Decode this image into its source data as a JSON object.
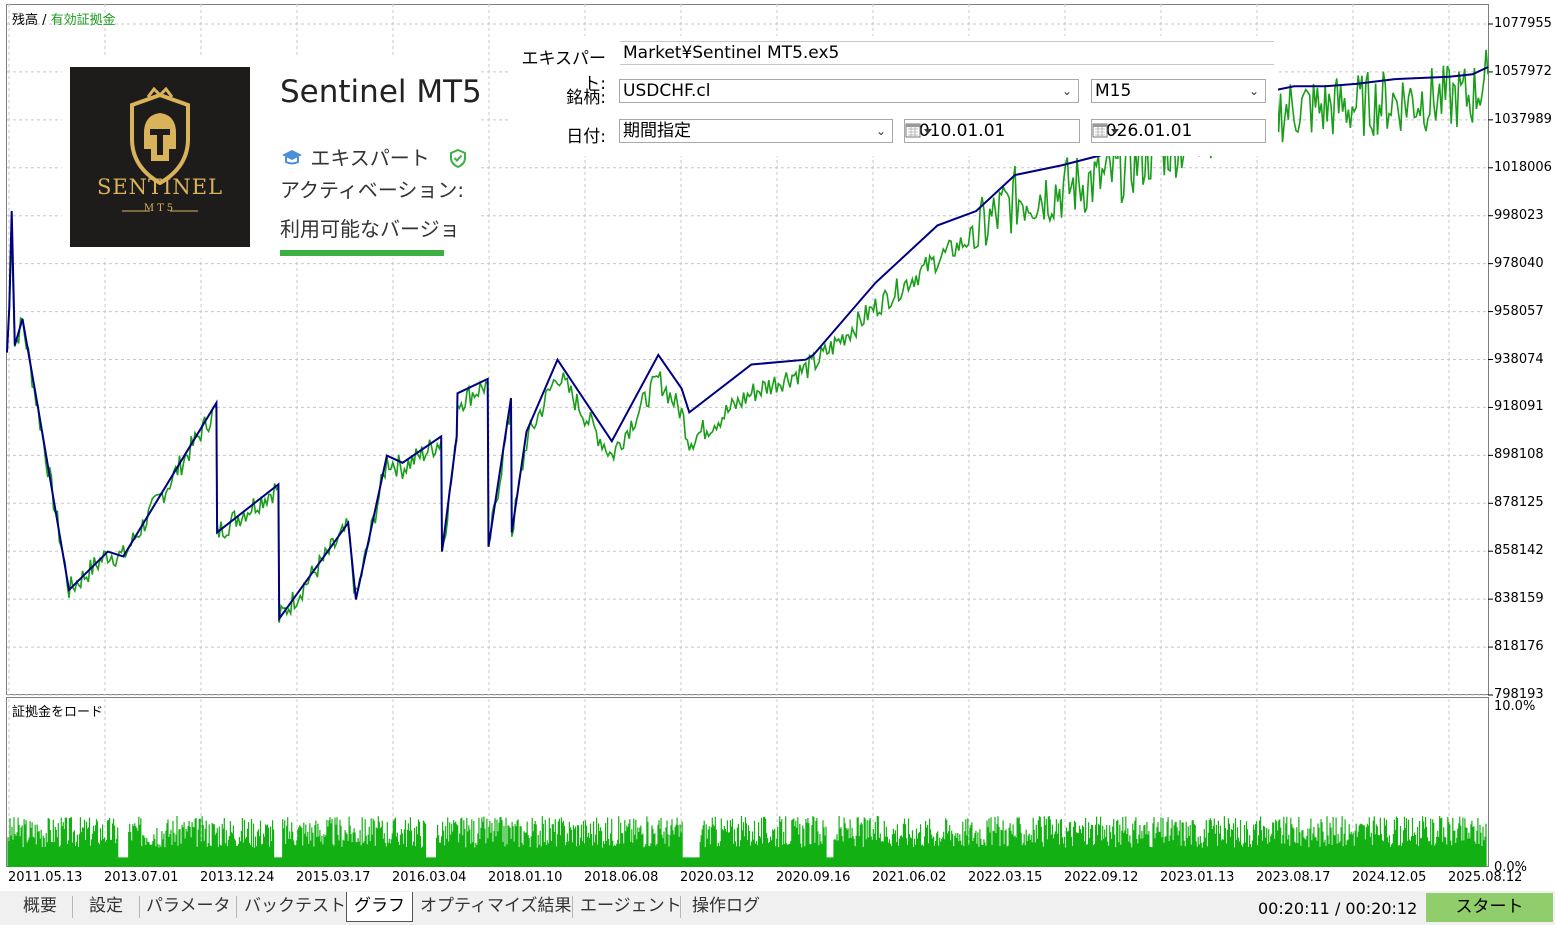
{
  "legend": {
    "balance_label": "残高",
    "separator": " / ",
    "equity_label": "有効証拠金"
  },
  "margin_legend": "証拠金をロード",
  "product": {
    "logo_word": "SENTINEL",
    "logo_sub": "MT5",
    "title": "Sentinel MT5",
    "type_label": "エキスパート",
    "activation_label": "アクティベーション:",
    "versions_label": "利用可能なバージョ",
    "icons": [
      "graduation-cap-icon",
      "verified-shield-icon"
    ]
  },
  "form": {
    "expert_label": "エキスパート:",
    "expert_value": "Market¥Sentinel MT5.ex5",
    "symbol_label": "銘柄:",
    "symbol_value": "USDCHF.cl",
    "timeframe_value": "M15",
    "date_label": "日付:",
    "date_mode": "期間指定",
    "date_from": "2010.01.01",
    "date_to": "2026.01.01"
  },
  "chart_data": [
    {
      "type": "line",
      "series": [
        {
          "name": "残高",
          "color": "#000080"
        },
        {
          "name": "有効証拠金",
          "color": "#1a9e1a"
        }
      ],
      "y_ticks": [
        "1077955",
        "1057972",
        "1037989",
        "1018006",
        "998023",
        "978040",
        "958057",
        "938074",
        "918091",
        "898108",
        "878125",
        "858142",
        "838159",
        "818176",
        "798193"
      ],
      "x_ticks": [
        "2011.05.13",
        "2013.07.01",
        "2013.12.24",
        "2015.03.17",
        "2016.03.04",
        "2018.01.10",
        "2018.06.08",
        "2020.03.12",
        "2020.09.16",
        "2021.06.02",
        "2022.03.15",
        "2022.09.12",
        "2023.01.13",
        "2023.08.17",
        "2024.12.05",
        "2025.08.12"
      ],
      "ylim": [
        798193,
        1077955
      ],
      "x": [
        0,
        0.3,
        0.6,
        1,
        2,
        4,
        8,
        13,
        15,
        27,
        27.1,
        35,
        35.1,
        44,
        45,
        49,
        51,
        56,
        56.1,
        58,
        58.1,
        62,
        62.1,
        65,
        65.1,
        67,
        71,
        78,
        84,
        87,
        88,
        96,
        103,
        104,
        112,
        120,
        125,
        130,
        136,
        142,
        148,
        153,
        154,
        161,
        163,
        166,
        170,
        174,
        179,
        186,
        189,
        191
      ],
      "balance": [
        941000,
        960000,
        1000000,
        944000,
        955000,
        918000,
        842000,
        858000,
        856000,
        920000,
        866000,
        886000,
        830000,
        870000,
        838000,
        898000,
        895000,
        906000,
        858000,
        906000,
        924000,
        930000,
        860000,
        922000,
        866000,
        908000,
        938000,
        904000,
        940000,
        926000,
        916000,
        936000,
        938000,
        940000,
        970000,
        994000,
        1000000,
        1015000,
        1019000,
        1024000,
        1035000,
        1039000,
        1044000,
        1049000,
        1050000,
        1052000,
        1052000,
        1053000,
        1055000,
        1056000,
        1057000,
        1060000
      ],
      "equity": [
        941000,
        958000,
        995000,
        944000,
        954000,
        917000,
        842000,
        857000,
        856000,
        918000,
        866000,
        885000,
        830000,
        868000,
        838000,
        896000,
        893000,
        904000,
        858000,
        904000,
        920000,
        928000,
        860000,
        918000,
        866000,
        904000,
        932000,
        898000,
        930000,
        916000,
        904000,
        924000,
        934000,
        936000,
        960000,
        980000,
        990000,
        1005000,
        1009000,
        1014000,
        1025000,
        1030000,
        1035000,
        1040000,
        1041000,
        1043000,
        1043000,
        1044000,
        1046000,
        1047000,
        1048000,
        1057000
      ]
    },
    {
      "type": "bar",
      "name": "証拠金をロード",
      "color": "#12b012",
      "y_ticks": [
        "10.0%",
        "0.0%"
      ],
      "ylim": [
        0,
        10
      ],
      "typical_level": 2.2,
      "bar_count": 1470
    }
  ],
  "tabs": [
    "概要",
    "設定",
    "パラメータ",
    "バックテスト",
    "グラフ",
    "オプティマイズ結果",
    "エージェント",
    "操作ログ"
  ],
  "active_tab": "グラフ",
  "timer": "00:20:11 / 00:20:12",
  "start_label": "スタート"
}
